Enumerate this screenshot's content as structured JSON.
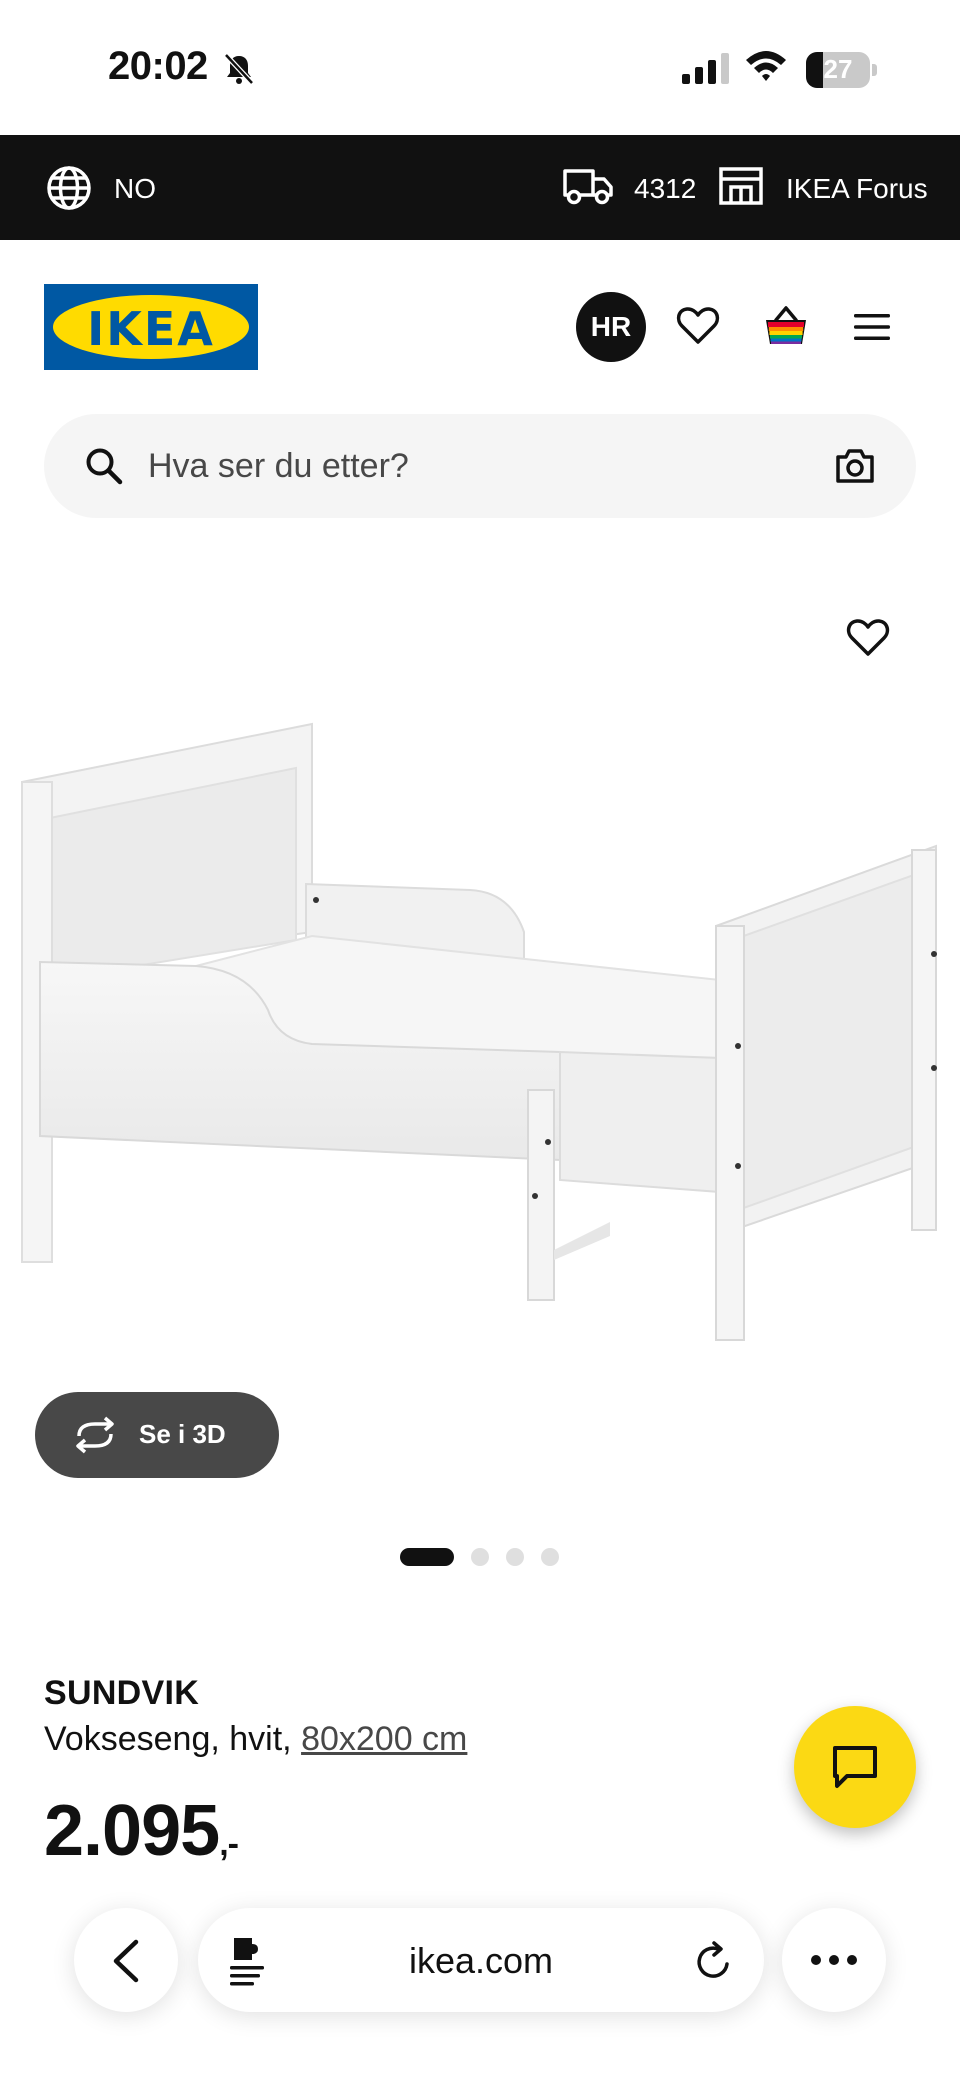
{
  "status_bar": {
    "time": "20:02",
    "battery": "27",
    "battery_level": 0.27
  },
  "top_bar": {
    "language": "NO",
    "postal_code": "4312",
    "store": "IKEA Forus"
  },
  "header": {
    "logo_text": "IKEA",
    "avatar_initials": "HR"
  },
  "search": {
    "placeholder": "Hva ser du etter?"
  },
  "gallery": {
    "view_3d_label": "Se i 3D",
    "total_images": 4,
    "active_index": 0
  },
  "product": {
    "name": "SUNDVIK",
    "description": "Vokseseng, hvit,",
    "size": "80x200 cm",
    "price": "2.095",
    "price_suffix": ",-"
  },
  "browser": {
    "url": "ikea.com"
  },
  "colors": {
    "ikea_blue": "#0058a3",
    "ikea_yellow": "#ffdb00",
    "chat_yellow": "#fbd914",
    "topbar_bg": "#111111"
  }
}
